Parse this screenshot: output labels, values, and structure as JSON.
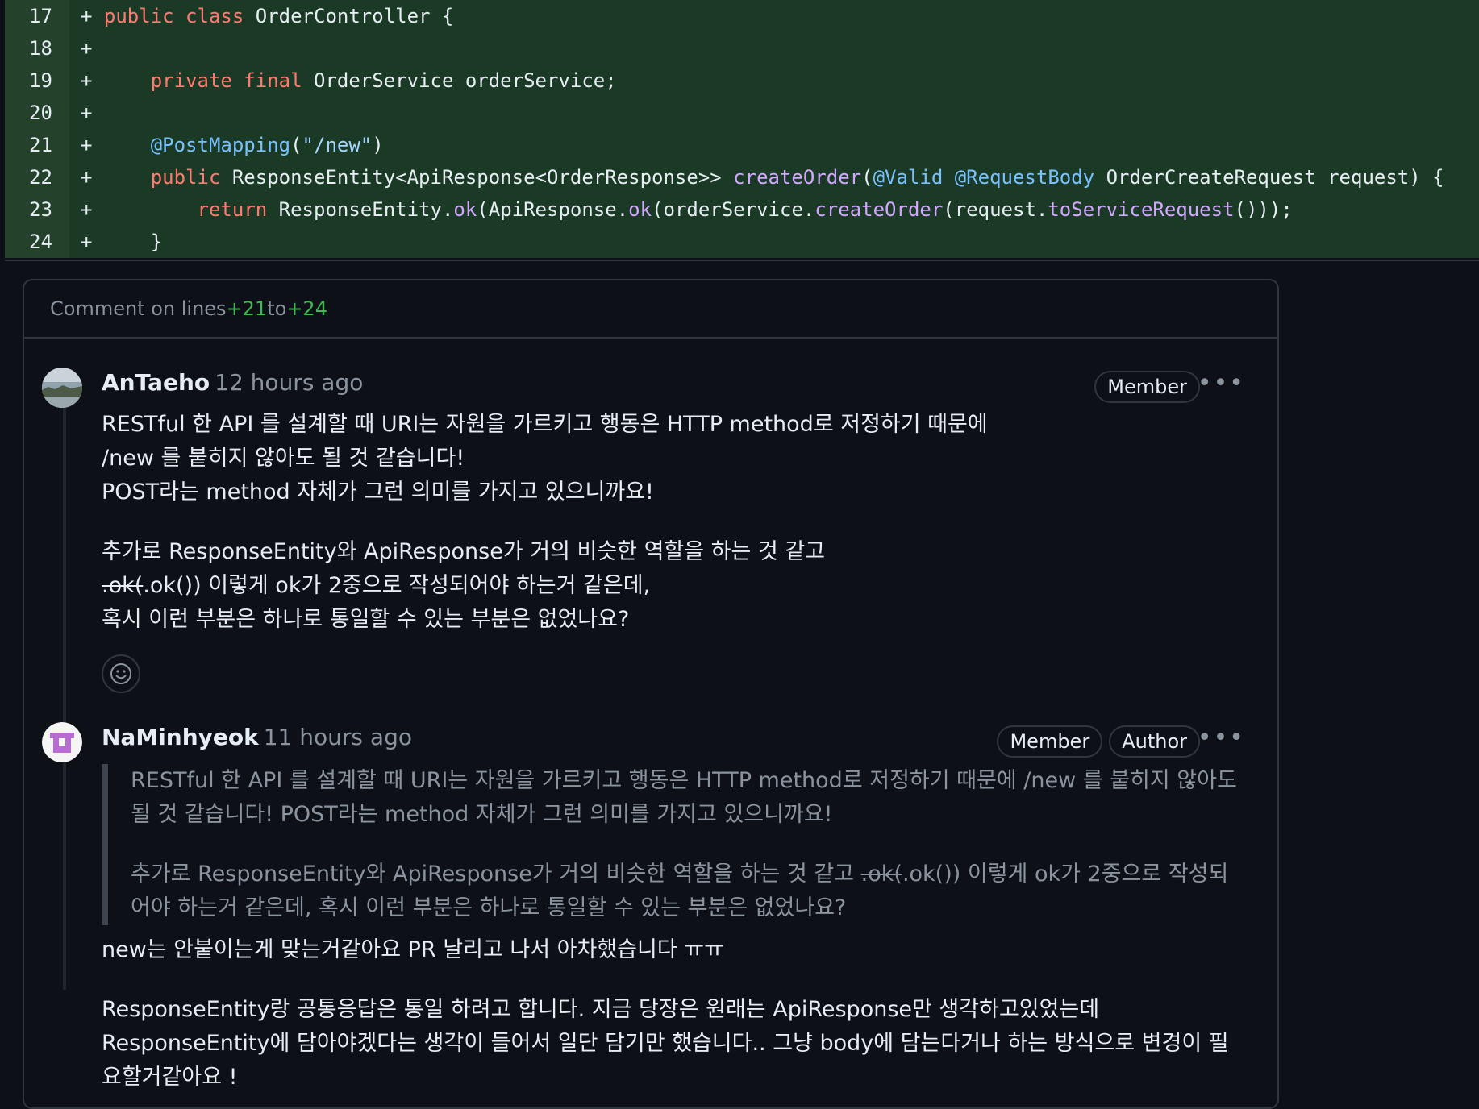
{
  "diff": {
    "lines": [
      {
        "num": "17",
        "sign": "+"
      },
      {
        "num": "18",
        "sign": "+"
      },
      {
        "num": "19",
        "sign": "+"
      },
      {
        "num": "20",
        "sign": "+"
      },
      {
        "num": "21",
        "sign": "+"
      },
      {
        "num": "22",
        "sign": "+"
      },
      {
        "num": "23",
        "sign": "+"
      },
      {
        "num": "24",
        "sign": "+"
      }
    ],
    "code": {
      "l17_kw": "public class",
      "l17_rest": " OrderController {",
      "l19_kw": "private final",
      "l19_rest": " OrderService orderService;",
      "l21_an": "@PostMapping",
      "l21_open": "(",
      "l21_str": "\"/new\"",
      "l21_close": ")",
      "l22_kw": "public",
      "l22_type": " ResponseEntity<ApiResponse<OrderResponse>> ",
      "l22_fn": "createOrder",
      "l22_p1": "(",
      "l22_an1": "@Valid",
      "l22_sp": " ",
      "l22_an2": "@RequestBody",
      "l22_rest": " OrderCreateRequest request) {",
      "l23_kw": "return",
      "l23_a": " ResponseEntity.",
      "l23_f1": "ok",
      "l23_b": "(ApiResponse.",
      "l23_f2": "ok",
      "l23_c": "(orderService.",
      "l23_f3": "createOrder",
      "l23_d": "(request.",
      "l23_f4": "toServiceRequest",
      "l23_e": "()));",
      "l24": "}"
    }
  },
  "thread": {
    "header_prefix": "Comment on lines ",
    "from": "+21",
    "to_word": " to ",
    "to": "+24"
  },
  "comments": [
    {
      "author": "AnTaeho",
      "time": "12 hours ago",
      "badge_member": "Member",
      "more": "•••",
      "lines_p1": [
        "RESTful 한 API 를 설계할 때 URI는 자원을 가르키고 행동은 HTTP method로 저정하기 때문에",
        "/new 를 붙히지 않아도 될 것 같습니다!",
        "POST라는 method 자체가 그런 의미를 가지고 있으니까요!"
      ],
      "p2_line1": "추가로 ResponseEntity와 ApiResponse가 거의 비슷한 역할을 하는 것 같고",
      "p2_strike": ".ok(",
      "p2_line2_rest": ".ok()) 이렇게 ok가 2중으로 작성되어야 하는거 같은데,",
      "p2_line3": "혹시 이런 부분은 하나로 통일할 수 있는 부분은 없었나요?"
    },
    {
      "author": "NaMinhyeok",
      "time": "11 hours ago",
      "badge_member": "Member",
      "badge_author": "Author",
      "more": "•••",
      "quote_p1": "RESTful 한 API 를 설계할 때 URI는 자원을 가르키고 행동은 HTTP method로 저정하기 때문에 /new 를 붙히지 않아도 될 것 같습니다! POST라는 method 자체가 그런 의미를 가지고 있으니까요!",
      "quote_p2_a": "추가로 ResponseEntity와 ApiResponse가 거의 비슷한 역할을 하는 것 같고 ",
      "quote_p2_strike": ".ok(",
      "quote_p2_b": ".ok()) 이렇게 ok가 2중으로 작성되어야 하는거 같은데, 혹시 이런 부분은 하나로 통일할 수 있는 부분은 없었나요?",
      "reply_p1": "new는 안붙이는게 맞는거같아요 PR 날리고 나서 아차했습니다 ㅠㅠ",
      "reply_p2": "ResponseEntity랑 공통응답은 통일 하려고 합니다. 지금 당장은 원래는 ApiResponse만 생각하고있었는데 ResponseEntity에 담아야겠다는 생각이 들어서 일단 담기만 했습니다.. 그냥 body에 담는다거나 하는 방식으로 변경이 필요할거같아요 !"
    }
  ]
}
